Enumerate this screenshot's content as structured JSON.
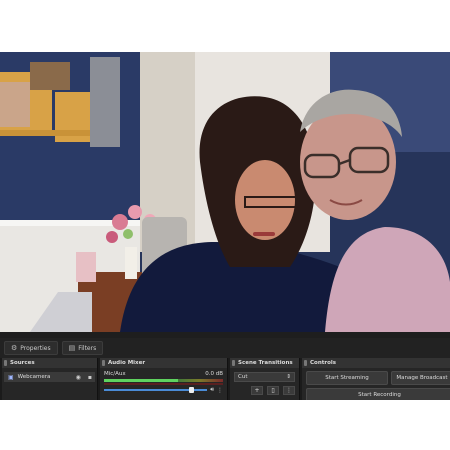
{
  "toolbar": {
    "properties_label": "Properties",
    "filters_label": "Filters",
    "properties_icon": "gear-icon",
    "filters_icon": "filter-icon"
  },
  "sources": {
    "title": "Sources",
    "items": [
      {
        "name": "Webcamera",
        "icon": "camera-icon"
      }
    ]
  },
  "audio_mixer": {
    "title": "Audio Mixer",
    "channel_name": "Mic/Aux",
    "level_text": "0.0 dB",
    "meter_level": 0.62,
    "volume_level": 0.85,
    "meter_color": "#5fd35f"
  },
  "scene_transitions": {
    "title": "Scene Transitions",
    "selected": "Cut"
  },
  "controls": {
    "title": "Controls",
    "start_streaming": "Start Streaming",
    "manage_broadcast": "Manage Broadcast",
    "start_recording": "Start Recording"
  }
}
